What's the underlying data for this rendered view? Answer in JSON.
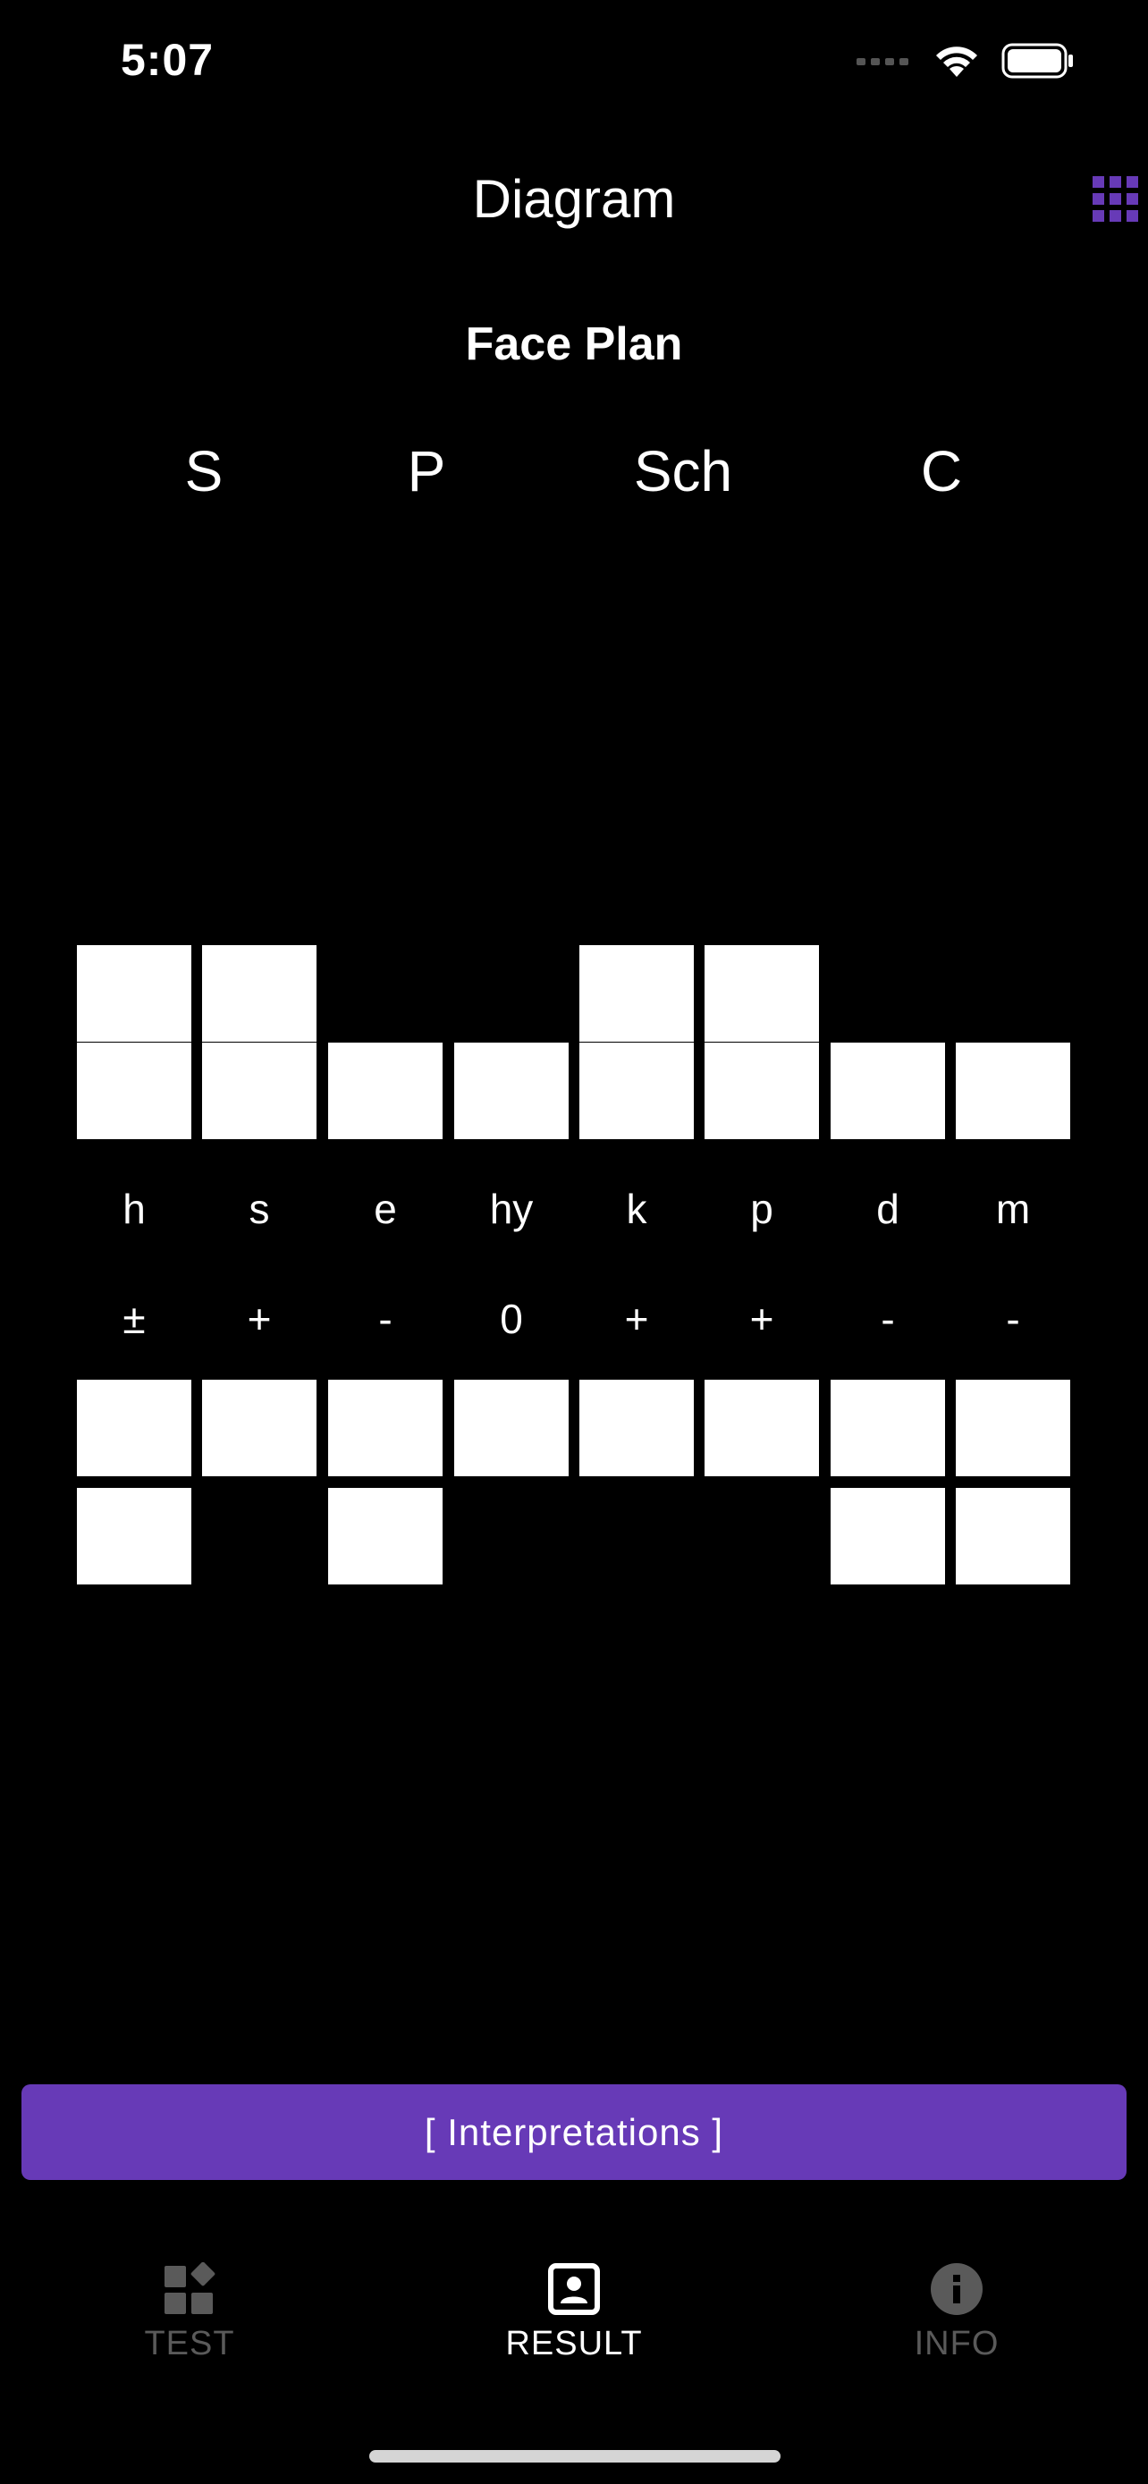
{
  "status_bar": {
    "time": "5:07"
  },
  "nav": {
    "title": "Diagram",
    "menu_icon": "grid-icon"
  },
  "section": {
    "title": "Face Plan"
  },
  "factors": [
    "S",
    "P",
    "Sch",
    "C"
  ],
  "columns": [
    {
      "label": "h",
      "sign": "±",
      "above": 2,
      "below": 2
    },
    {
      "label": "s",
      "sign": "+",
      "above": 2,
      "below": 1
    },
    {
      "label": "e",
      "sign": "-",
      "above": 1,
      "below": 2
    },
    {
      "label": "hy",
      "sign": "0",
      "above": 1,
      "below": 1
    },
    {
      "label": "k",
      "sign": "+",
      "above": 2,
      "below": 1
    },
    {
      "label": "p",
      "sign": "+",
      "above": 2,
      "below": 1
    },
    {
      "label": "d",
      "sign": "-",
      "above": 1,
      "below": 2
    },
    {
      "label": "m",
      "sign": "-",
      "above": 1,
      "below": 2
    }
  ],
  "cta": {
    "label": "[ Interpretations ]"
  },
  "tabs": [
    {
      "label": "TEST",
      "icon": "widgets-icon",
      "active": false
    },
    {
      "label": "RESULT",
      "icon": "portrait-icon",
      "active": true
    },
    {
      "label": "INFO",
      "icon": "info-icon",
      "active": false
    }
  ],
  "colors": {
    "accent": "#673ab7",
    "inactive_tab": "#5a5a5a",
    "active_tab": "#ffffff"
  }
}
